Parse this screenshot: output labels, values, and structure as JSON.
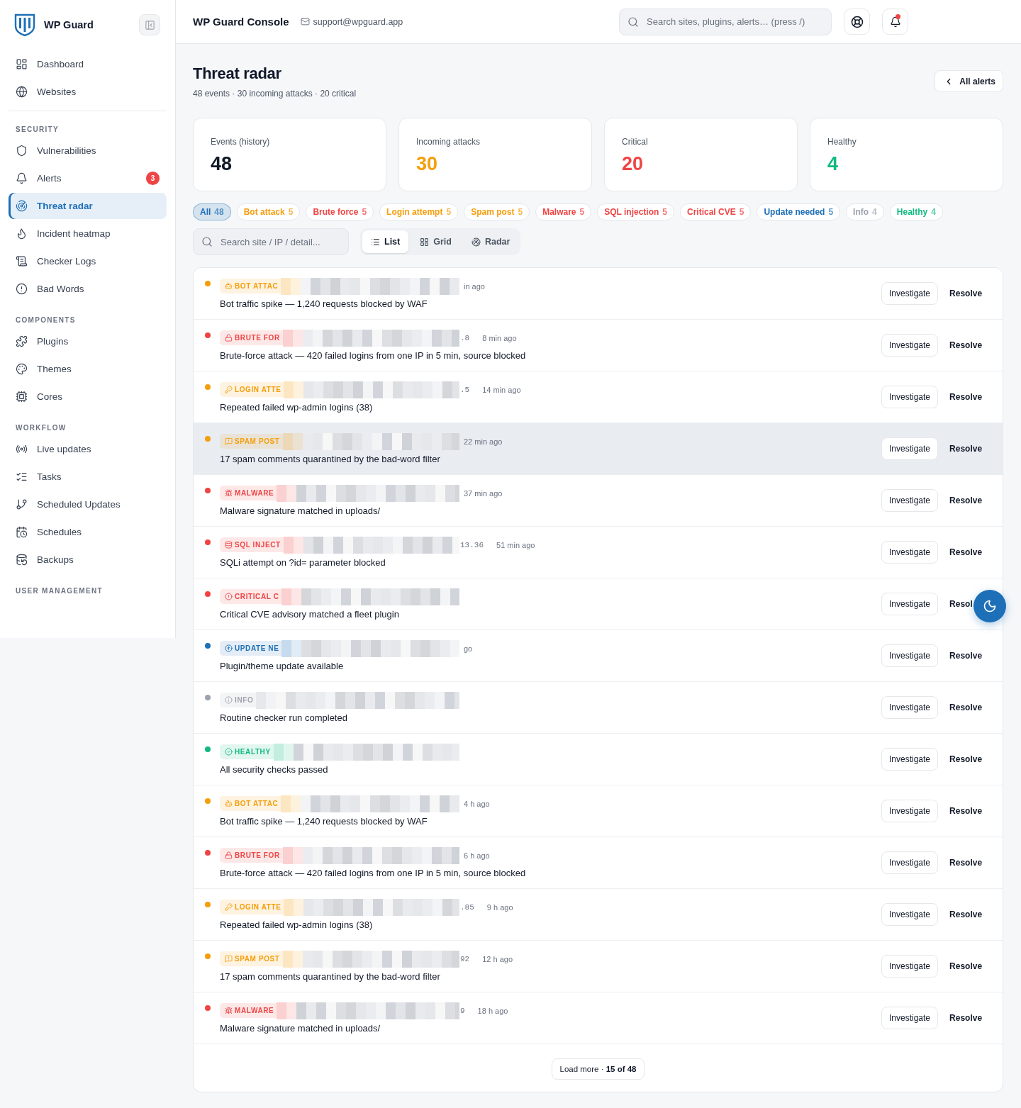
{
  "sidebar": {
    "brand": "WP Guard",
    "groups": [
      {
        "items": [
          {
            "label": "Dashboard",
            "selected": false
          },
          {
            "label": "Websites",
            "selected": false
          }
        ]
      },
      {
        "heading": "SECURITY",
        "items": [
          {
            "label": "Vulnerabilities",
            "selected": false
          },
          {
            "label": "Alerts",
            "selected": false,
            "badge": "3"
          },
          {
            "label": "Threat radar",
            "selected": true
          },
          {
            "label": "Incident heatmap",
            "selected": false
          },
          {
            "label": "Checker Logs",
            "selected": false
          },
          {
            "label": "Bad Words",
            "selected": false
          }
        ]
      },
      {
        "heading": "COMPONENTS",
        "items": [
          {
            "label": "Plugins",
            "selected": false
          },
          {
            "label": "Themes",
            "selected": false
          },
          {
            "label": "Cores",
            "selected": false
          }
        ]
      },
      {
        "heading": "WORKFLOW",
        "items": [
          {
            "label": "Live updates",
            "selected": false
          },
          {
            "label": "Tasks",
            "selected": false
          },
          {
            "label": "Scheduled Updates",
            "selected": false
          },
          {
            "label": "Schedules",
            "selected": false
          },
          {
            "label": "Backups",
            "selected": false
          }
        ]
      },
      {
        "heading": "USER MANAGEMENT"
      }
    ]
  },
  "header": {
    "title": "WP Guard Console",
    "email": "support@wpguard.app",
    "search": {
      "placeholder": "Search sites, plugins, alerts… (press /)"
    },
    "notifications": {
      "unread": true
    }
  },
  "page": {
    "title": "Threat radar",
    "subtitle": "48 events · 30 incoming attacks · 20 critical",
    "back_button": "All alerts"
  },
  "stats": [
    {
      "label": "Events (history)",
      "value": "48",
      "color": "#111827"
    },
    {
      "label": "Incoming attacks",
      "value": "30",
      "color": "#f59e0b"
    },
    {
      "label": "Critical",
      "value": "20",
      "color": "#ef4444"
    },
    {
      "label": "Healthy",
      "value": "4",
      "color": "#10b981"
    }
  ],
  "filters": [
    {
      "label": "All",
      "count": "48",
      "selected": true,
      "color": "#1d6fb8"
    },
    {
      "label": "Bot attack",
      "count": "5",
      "selected": false,
      "color": "#f59e0b"
    },
    {
      "label": "Brute force",
      "count": "5",
      "selected": false,
      "color": "#ef4444"
    },
    {
      "label": "Login attempt",
      "count": "5",
      "selected": false,
      "color": "#f59e0b"
    },
    {
      "label": "Spam post",
      "count": "5",
      "selected": false,
      "color": "#f59e0b"
    },
    {
      "label": "Malware",
      "count": "5",
      "selected": false,
      "color": "#ef4444"
    },
    {
      "label": "SQL injection",
      "count": "5",
      "selected": false,
      "color": "#ef4444"
    },
    {
      "label": "Critical CVE",
      "count": "5",
      "selected": false,
      "color": "#ef4444"
    },
    {
      "label": "Update needed",
      "count": "5",
      "selected": false,
      "color": "#1d6fb8"
    },
    {
      "label": "Info",
      "count": "4",
      "selected": false,
      "color": "#9ca3af"
    },
    {
      "label": "Healthy",
      "count": "4",
      "selected": false,
      "color": "#10b981"
    }
  ],
  "search": {
    "placeholder": "Search site / IP / detail..."
  },
  "views": [
    {
      "label": "List",
      "selected": true
    },
    {
      "label": "Grid",
      "selected": false
    },
    {
      "label": "Radar",
      "selected": false
    }
  ],
  "events": [
    {
      "kind": "bot",
      "tag": "BOT ATTAC",
      "time": "in ago",
      "title": "Bot traffic spike — 1,240 requests blocked by WAF",
      "color": "#f59e0b",
      "highlighted": false,
      "actions": [
        {
          "kind": "investigate",
          "label": "Investigate"
        },
        {
          "kind": "resolve",
          "label": "Resolve"
        }
      ]
    },
    {
      "kind": "brute_force",
      "tag": "BRUTE FOR",
      "fragment": ".8",
      "time": "8 min ago",
      "title": "Brute-force attack — 420 failed logins from one IP in 5 min, source blocked",
      "color": "#ef4444",
      "highlighted": false,
      "actions": [
        {
          "kind": "investigate",
          "label": "Investigate"
        },
        {
          "kind": "resolve",
          "label": "Resolve"
        }
      ]
    },
    {
      "kind": "login",
      "tag": "LOGIN ATTE",
      "fragment": ".5",
      "time": "14 min ago",
      "title": "Repeated failed wp-admin logins (38)",
      "color": "#f59e0b",
      "highlighted": false,
      "actions": [
        {
          "kind": "investigate",
          "label": "Investigate"
        },
        {
          "kind": "resolve",
          "label": "Resolve"
        }
      ]
    },
    {
      "kind": "spam",
      "tag": "SPAM POST",
      "time": "22 min ago",
      "title": "17 spam comments quarantined by the bad-word filter",
      "color": "#f59e0b",
      "highlighted": true,
      "actions": [
        {
          "kind": "investigate",
          "label": "Investigate"
        },
        {
          "kind": "resolve",
          "label": "Resolve"
        }
      ]
    },
    {
      "kind": "malware",
      "tag": "MALWARE",
      "time": "37 min ago",
      "title": "Malware signature matched in uploads/",
      "color": "#ef4444",
      "highlighted": false,
      "actions": [
        {
          "kind": "investigate",
          "label": "Investigate"
        },
        {
          "kind": "resolve",
          "label": "Resolve"
        }
      ]
    },
    {
      "kind": "sql",
      "tag": "SQL INJECT",
      "fragment": "13.36",
      "time": "51 min ago",
      "title": "SQLi attempt on ?id= parameter blocked",
      "color": "#ef4444",
      "highlighted": false,
      "actions": [
        {
          "kind": "investigate",
          "label": "Investigate"
        },
        {
          "kind": "resolve",
          "label": "Resolve"
        }
      ]
    },
    {
      "kind": "cve",
      "tag": "CRITICAL C",
      "title": "Critical CVE advisory matched a fleet plugin",
      "color": "#ef4444",
      "highlighted": false,
      "actions": [
        {
          "kind": "investigate",
          "label": "Investigate"
        },
        {
          "kind": "resolve",
          "label": "Resol"
        }
      ]
    },
    {
      "kind": "update",
      "tag": "UPDATE NE",
      "time": "go",
      "title": "Plugin/theme update available",
      "color": "#1d6fb8",
      "highlighted": false,
      "actions": [
        {
          "kind": "investigate",
          "label": "Investigate"
        },
        {
          "kind": "resolve",
          "label": "Resolve"
        }
      ]
    },
    {
      "kind": "info",
      "tag": "INFO",
      "title": "Routine checker run completed",
      "color": "#9ca3af",
      "highlighted": false,
      "actions": [
        {
          "kind": "investigate",
          "label": "Investigate"
        },
        {
          "kind": "resolve",
          "label": "Resolve"
        }
      ]
    },
    {
      "kind": "healthy",
      "tag": "HEALTHY",
      "title": "All security checks passed",
      "color": "#10b981",
      "highlighted": false,
      "actions": [
        {
          "kind": "investigate",
          "label": "Investigate"
        },
        {
          "kind": "resolve",
          "label": "Resolve"
        }
      ]
    },
    {
      "kind": "bot",
      "tag": "BOT ATTAC",
      "time": "4 h ago",
      "title": "Bot traffic spike — 1,240 requests blocked by WAF",
      "color": "#f59e0b",
      "highlighted": false,
      "actions": [
        {
          "kind": "investigate",
          "label": "Investigate"
        },
        {
          "kind": "resolve",
          "label": "Resolve"
        }
      ]
    },
    {
      "kind": "brute_force",
      "tag": "BRUTE FOR",
      "time": "6 h ago",
      "title": "Brute-force attack — 420 failed logins from one IP in 5 min, source blocked",
      "color": "#ef4444",
      "highlighted": false,
      "actions": [
        {
          "kind": "investigate",
          "label": "Investigate"
        },
        {
          "kind": "resolve",
          "label": "Resolve"
        }
      ]
    },
    {
      "kind": "login",
      "tag": "LOGIN ATTE",
      "fragment": ".85",
      "time": "9 h ago",
      "title": "Repeated failed wp-admin logins (38)",
      "color": "#f59e0b",
      "highlighted": false,
      "actions": [
        {
          "kind": "investigate",
          "label": "Investigate"
        },
        {
          "kind": "resolve",
          "label": "Resolve"
        }
      ]
    },
    {
      "kind": "spam",
      "tag": "SPAM POST",
      "fragment": "92",
      "time": "12 h ago",
      "title": "17 spam comments quarantined by the bad-word filter",
      "color": "#f59e0b",
      "highlighted": false,
      "actions": [
        {
          "kind": "investigate",
          "label": "Investigate"
        },
        {
          "kind": "resolve",
          "label": "Resolve"
        }
      ]
    },
    {
      "kind": "malware",
      "tag": "MALWARE",
      "fragment": "9",
      "time": "18 h ago",
      "title": "Malware signature matched in uploads/",
      "color": "#ef4444",
      "highlighted": false,
      "actions": [
        {
          "kind": "investigate",
          "label": "Investigate"
        },
        {
          "kind": "resolve",
          "label": "Resolve"
        }
      ]
    }
  ],
  "load_more": "Load more · **15 of 48**"
}
